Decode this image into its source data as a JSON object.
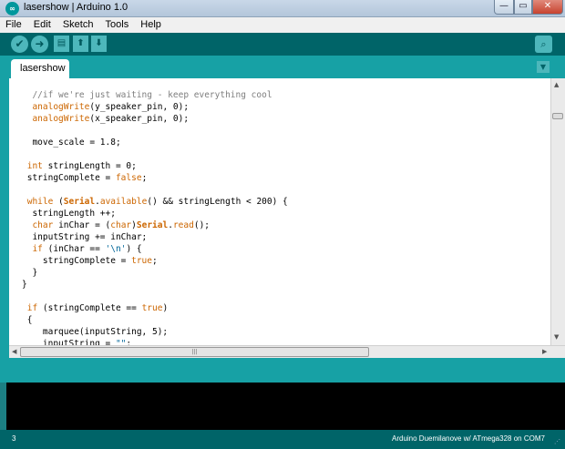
{
  "window": {
    "title": "lasershow | Arduino 1.0",
    "logo_text": "∞",
    "buttons": {
      "minimize": "—",
      "maximize": "▭",
      "close": "✕"
    }
  },
  "menu": [
    "File",
    "Edit",
    "Sketch",
    "Tools",
    "Help"
  ],
  "toolbar": {
    "verify_icon": "check-icon",
    "upload_icon": "arrow-right-icon",
    "new_icon": "new-file-icon",
    "open_icon": "arrow-up-icon",
    "save_icon": "arrow-down-icon",
    "serial_icon": "magnifier-icon",
    "glyphs": {
      "verify": "✔",
      "upload": "➜",
      "new": "▤",
      "open": "⬆",
      "save": "⬇",
      "serial": "⌕"
    }
  },
  "tabs": {
    "active": "lasershow",
    "menu_glyph": "▼"
  },
  "code_lines": [
    [
      {
        "t": "  ",
        "c": ""
      },
      {
        "t": "//if we're just waiting - keep everything cool",
        "c": "t-comment"
      }
    ],
    [
      {
        "t": "  ",
        "c": ""
      },
      {
        "t": "analogWrite",
        "c": "t-func"
      },
      {
        "t": "(y_speaker_pin, 0);",
        "c": ""
      }
    ],
    [
      {
        "t": "  ",
        "c": ""
      },
      {
        "t": "analogWrite",
        "c": "t-func"
      },
      {
        "t": "(x_speaker_pin, 0);",
        "c": ""
      }
    ],
    [
      {
        "t": "",
        "c": ""
      }
    ],
    [
      {
        "t": "  move_scale = 1.8;",
        "c": ""
      }
    ],
    [
      {
        "t": "",
        "c": ""
      }
    ],
    [
      {
        "t": " ",
        "c": ""
      },
      {
        "t": "int",
        "c": "t-type"
      },
      {
        "t": " stringLength = 0;",
        "c": ""
      }
    ],
    [
      {
        "t": " stringComplete = ",
        "c": ""
      },
      {
        "t": "false",
        "c": "t-const"
      },
      {
        "t": ";",
        "c": ""
      }
    ],
    [
      {
        "t": "",
        "c": ""
      }
    ],
    [
      {
        "t": " ",
        "c": ""
      },
      {
        "t": "while",
        "c": "t-kw"
      },
      {
        "t": " (",
        "c": ""
      },
      {
        "t": "Serial",
        "c": "t-class"
      },
      {
        "t": ".",
        "c": ""
      },
      {
        "t": "available",
        "c": "t-func"
      },
      {
        "t": "() && stringLength < 200) {",
        "c": ""
      }
    ],
    [
      {
        "t": "  stringLength ++;",
        "c": ""
      }
    ],
    [
      {
        "t": "  ",
        "c": ""
      },
      {
        "t": "char",
        "c": "t-type"
      },
      {
        "t": " inChar = (",
        "c": ""
      },
      {
        "t": "char",
        "c": "t-type"
      },
      {
        "t": ")",
        "c": ""
      },
      {
        "t": "Serial",
        "c": "t-class"
      },
      {
        "t": ".",
        "c": ""
      },
      {
        "t": "read",
        "c": "t-func"
      },
      {
        "t": "();",
        "c": ""
      }
    ],
    [
      {
        "t": "  inputString += inChar;",
        "c": ""
      }
    ],
    [
      {
        "t": "  ",
        "c": ""
      },
      {
        "t": "if",
        "c": "t-kw"
      },
      {
        "t": " (inChar == ",
        "c": ""
      },
      {
        "t": "'\\n'",
        "c": "t-str"
      },
      {
        "t": ") {",
        "c": ""
      }
    ],
    [
      {
        "t": "    stringComplete = ",
        "c": ""
      },
      {
        "t": "true",
        "c": "t-const"
      },
      {
        "t": ";",
        "c": ""
      }
    ],
    [
      {
        "t": "  }",
        "c": ""
      }
    ],
    [
      {
        "t": "}",
        "c": ""
      }
    ],
    [
      {
        "t": "",
        "c": ""
      }
    ],
    [
      {
        "t": " ",
        "c": ""
      },
      {
        "t": "if",
        "c": "t-kw"
      },
      {
        "t": " (stringComplete == ",
        "c": ""
      },
      {
        "t": "true",
        "c": "t-const"
      },
      {
        "t": ")",
        "c": ""
      }
    ],
    [
      {
        "t": " {",
        "c": ""
      }
    ],
    [
      {
        "t": "    marquee(inputString, 5);",
        "c": ""
      }
    ],
    [
      {
        "t": "    inputString = ",
        "c": ""
      },
      {
        "t": "\"\"",
        "c": "t-str"
      },
      {
        "t": ";",
        "c": ""
      }
    ]
  ],
  "scrollbars": {
    "up": "▲",
    "down": "▼",
    "left": "◀",
    "right": "▶",
    "grip": "|||"
  },
  "status": {
    "line": "3",
    "board": "Arduino Duemilanove w/ ATmega328 on COM7",
    "grip": "⋰"
  }
}
